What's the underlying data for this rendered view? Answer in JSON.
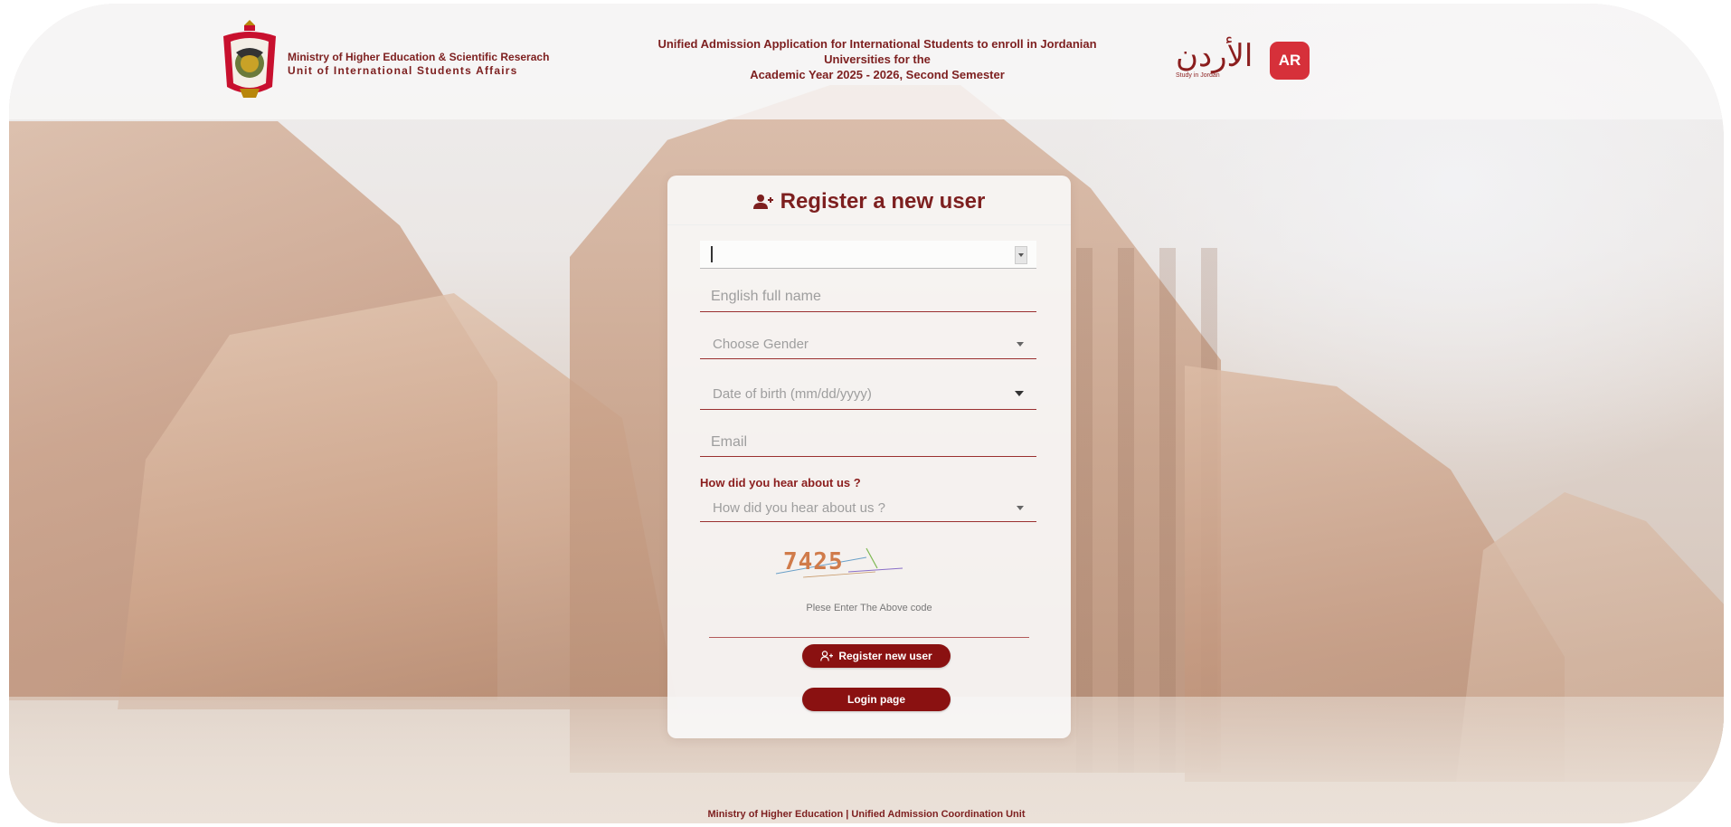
{
  "header": {
    "ministry_line1": "Ministry of Higher Education & Scientific Reserach",
    "ministry_line2": "Unit of International Students Affairs",
    "title_line1": "Unified Admission Application for International Students to enroll in Jordanian",
    "title_line2": "Universities for the",
    "title_line3": "Academic Year 2025 - 2026, Second Semester",
    "jordan_logo_text": "الأردن",
    "jordan_logo_small": "Study in Jordan",
    "language_button": "AR"
  },
  "form": {
    "title": "Register a new user",
    "country_value": "",
    "full_name_placeholder": "English full name",
    "gender_placeholder": "Choose Gender",
    "dob_placeholder": "Date of birth (mm/dd/yyyy)",
    "email_placeholder": "Email",
    "hear_label": "How did you hear about us ?",
    "hear_placeholder": "How did you hear about us ?",
    "captcha_code": "7425",
    "captcha_hint": "Plese Enter The Above code",
    "captcha_value": "",
    "register_button": "Register new user",
    "login_button": "Login page"
  },
  "footer": {
    "text": "Ministry of Higher Education | Unified Admission Coordination Unit"
  },
  "colors": {
    "brand_maroon": "#7d1f1f",
    "button_red": "#8a1111",
    "ar_button": "#d6303a",
    "captcha_orange": "#d07b4a"
  },
  "icons": {
    "title_icon": "user-plus-icon",
    "register_icon": "user-add-icon",
    "emblem": "jordan-coat-of-arms-icon"
  }
}
